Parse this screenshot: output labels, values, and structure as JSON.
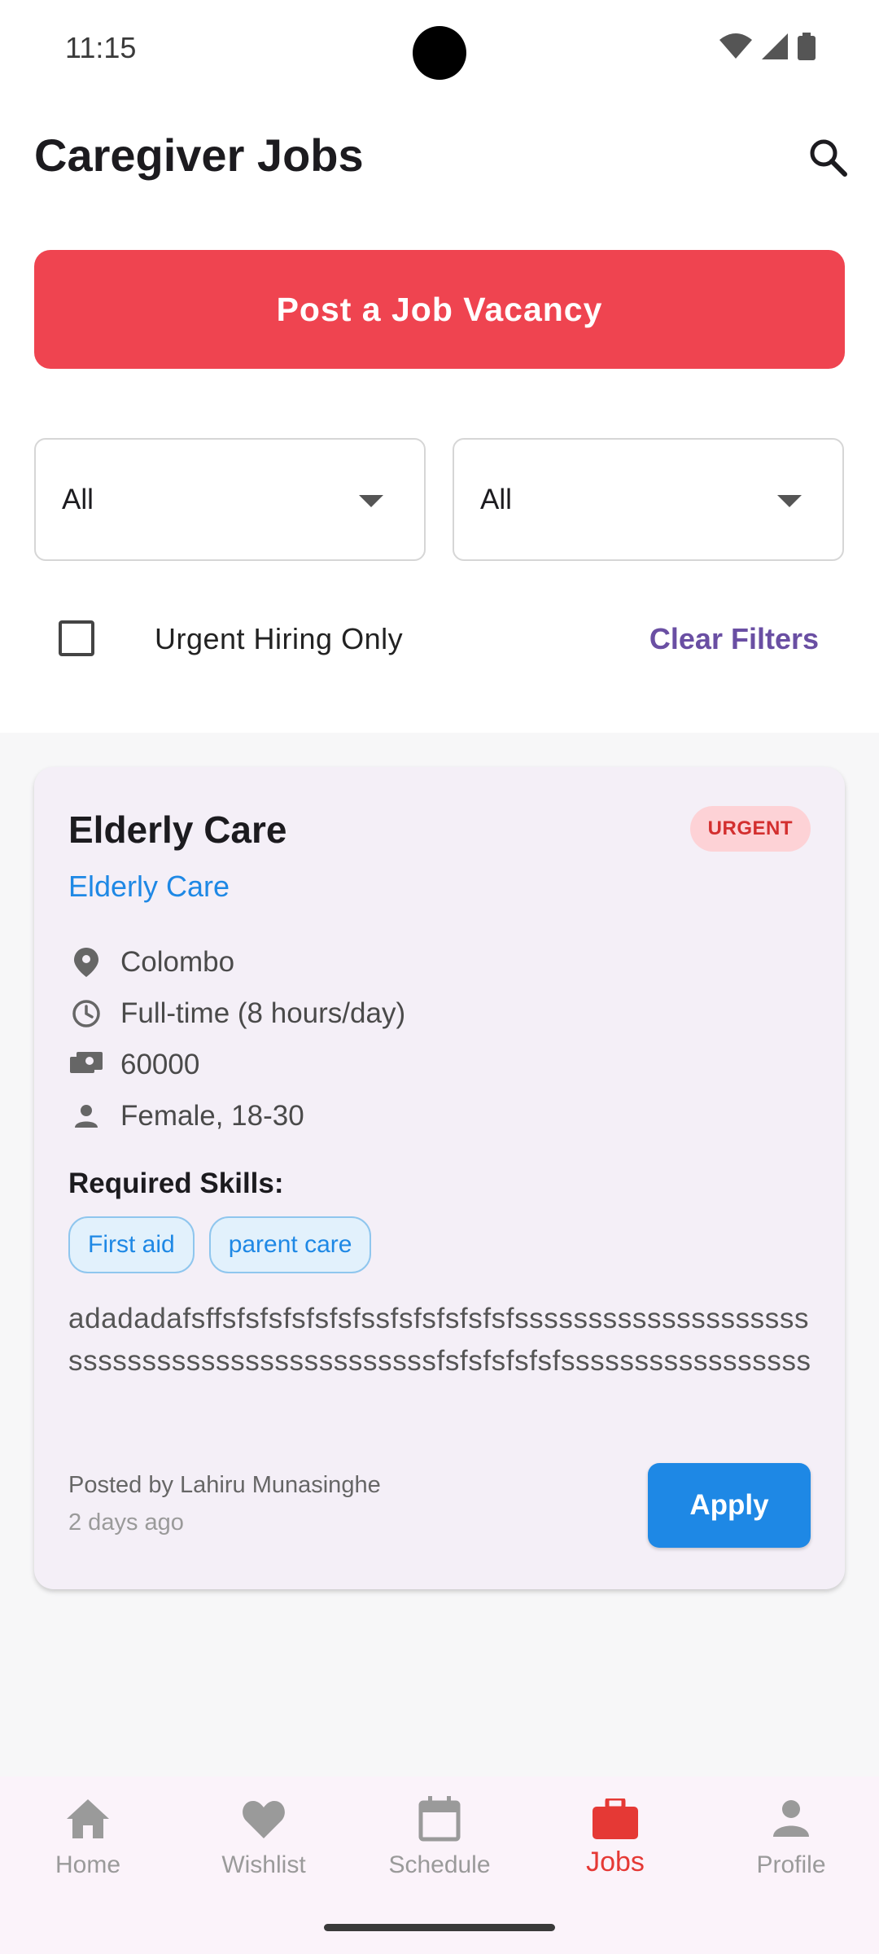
{
  "status_bar": {
    "time": "11:15"
  },
  "app_bar": {
    "title": "Caregiver Jobs"
  },
  "post_button": {
    "label": "Post a Job Vacancy"
  },
  "filters": {
    "dropdown1": {
      "value": "All"
    },
    "dropdown2": {
      "value": "All"
    },
    "urgent_label": "Urgent Hiring Only",
    "urgent_checked": false,
    "clear_label": "Clear Filters"
  },
  "job": {
    "title": "Elderly Care",
    "badge": "URGENT",
    "category": "Elderly Care",
    "location": "Colombo",
    "schedule": "Full-time (8 hours/day)",
    "salary": "60000",
    "requirement": "Female, 18-30",
    "skills_title": "Required Skills:",
    "skills": [
      "First aid",
      "parent care"
    ],
    "description": "adadadafsffsfsfsfsfsfsfssfsfsfsfsfsfsssssssssssssssssssssssssssssssssssssssssssssfsfsfsfsfsfsssssssssssssssss",
    "posted_by": "Posted by Lahiru Munasinghe",
    "posted_time": "2 days ago",
    "apply_label": "Apply"
  },
  "bottom_nav": {
    "items": [
      {
        "label": "Home",
        "icon": "home-icon",
        "active": false
      },
      {
        "label": "Wishlist",
        "icon": "heart-icon",
        "active": false
      },
      {
        "label": "Schedule",
        "icon": "calendar-icon",
        "active": false
      },
      {
        "label": "Jobs",
        "icon": "briefcase-icon",
        "active": true
      },
      {
        "label": "Profile",
        "icon": "person-icon",
        "active": false
      }
    ]
  },
  "colors": {
    "primary_red": "#ef4450",
    "accent_blue": "#1e88e5",
    "accent_purple": "#6a4fa3",
    "active_nav": "#e53935"
  }
}
